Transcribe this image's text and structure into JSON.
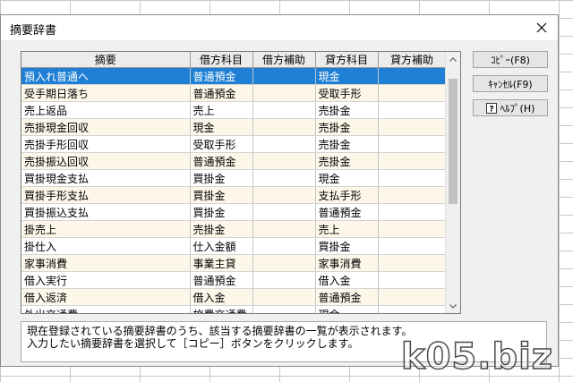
{
  "window": {
    "title": "摘要辞書"
  },
  "table": {
    "columns": [
      "摘要",
      "借方科目",
      "借方補助",
      "貸方科目",
      "貸方補助"
    ],
    "rows": [
      [
        "預入れ普通へ",
        "普通預金",
        "",
        "現金",
        ""
      ],
      [
        "受手期日落ち",
        "普通預金",
        "",
        "受取手形",
        ""
      ],
      [
        "売上返品",
        "売上",
        "",
        "売掛金",
        ""
      ],
      [
        "売掛現金回収",
        "現金",
        "",
        "売掛金",
        ""
      ],
      [
        "売掛手形回収",
        "受取手形",
        "",
        "売掛金",
        ""
      ],
      [
        "売掛振込回収",
        "普通預金",
        "",
        "売掛金",
        ""
      ],
      [
        "買掛現金支払",
        "買掛金",
        "",
        "現金",
        ""
      ],
      [
        "買掛手形支払",
        "買掛金",
        "",
        "支払手形",
        ""
      ],
      [
        "買掛振込支払",
        "買掛金",
        "",
        "普通預金",
        ""
      ],
      [
        "掛売上",
        "売掛金",
        "",
        "売上",
        ""
      ],
      [
        "掛仕入",
        "仕入金額",
        "",
        "買掛金",
        ""
      ],
      [
        "家事消費",
        "事業主貸",
        "",
        "家事消費",
        ""
      ],
      [
        "借入実行",
        "普通預金",
        "",
        "借入金",
        ""
      ],
      [
        "借入返済",
        "借入金",
        "",
        "普通預金",
        ""
      ],
      [
        "外出交通費",
        "旅費交通費",
        "",
        "現金",
        ""
      ]
    ],
    "selected_row": 0
  },
  "buttons": {
    "copy": "ｺﾋﾟｰ(F8)",
    "cancel": "ｷｬﾝｾﾙ(F9)",
    "help": "ﾍﾙﾌﾟ(H)"
  },
  "description": {
    "line1": "現在登録されている摘要辞書のうち、該当する摘要辞書の一覧が表示されます。",
    "line2": "入力したい摘要辞書を選択して［コピー］ボタンをクリックします。"
  },
  "watermark": "k05.biz",
  "icons": {
    "close": "close-icon",
    "help": "help-icon",
    "scroll_up": "scroll-up-arrow-icon",
    "scroll_down": "scroll-down-arrow-icon"
  }
}
